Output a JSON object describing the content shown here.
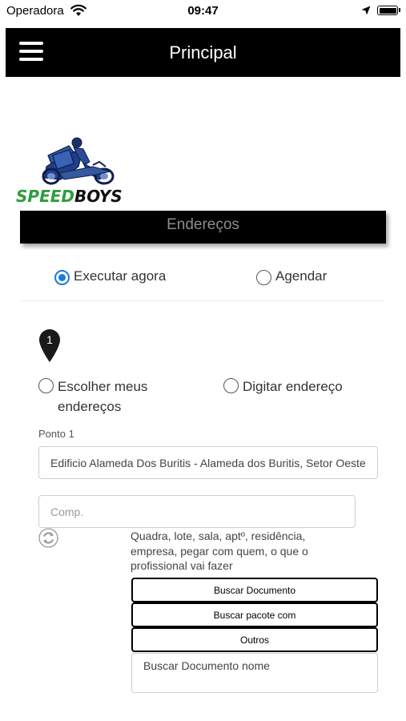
{
  "status_bar": {
    "carrier": "Operadora",
    "time": "09:47"
  },
  "navbar": {
    "title": "Principal"
  },
  "logo": {
    "text_part1": "SPEED",
    "text_part2": "BOYS"
  },
  "section": {
    "title": "Endereços"
  },
  "schedule_options": {
    "now_label": "Executar agora",
    "now_selected": true,
    "schedule_label": "Agendar",
    "schedule_selected": false
  },
  "point": {
    "number": "1",
    "choose_saved_line1": "Escolher meus",
    "choose_saved_line2": "endereços",
    "type_address_label": "Digitar endereço",
    "field_label": "Ponto 1",
    "address_value": "Edificio Alameda Dos Buritis - Alameda dos Buritis, Setor Oeste",
    "complement_placeholder": "Comp.",
    "hint": "Quadra, lote, sala, aptº, residência, empresa, pegar com quem, o que o profissional vai fazer",
    "options": [
      "Buscar Documento",
      "Buscar pacote com",
      "Outros"
    ],
    "details_value": "Buscar Documento nome"
  },
  "colors": {
    "accent": "#1a7bd8",
    "bar": "#000000",
    "logo_green": "#2e9d3d"
  }
}
